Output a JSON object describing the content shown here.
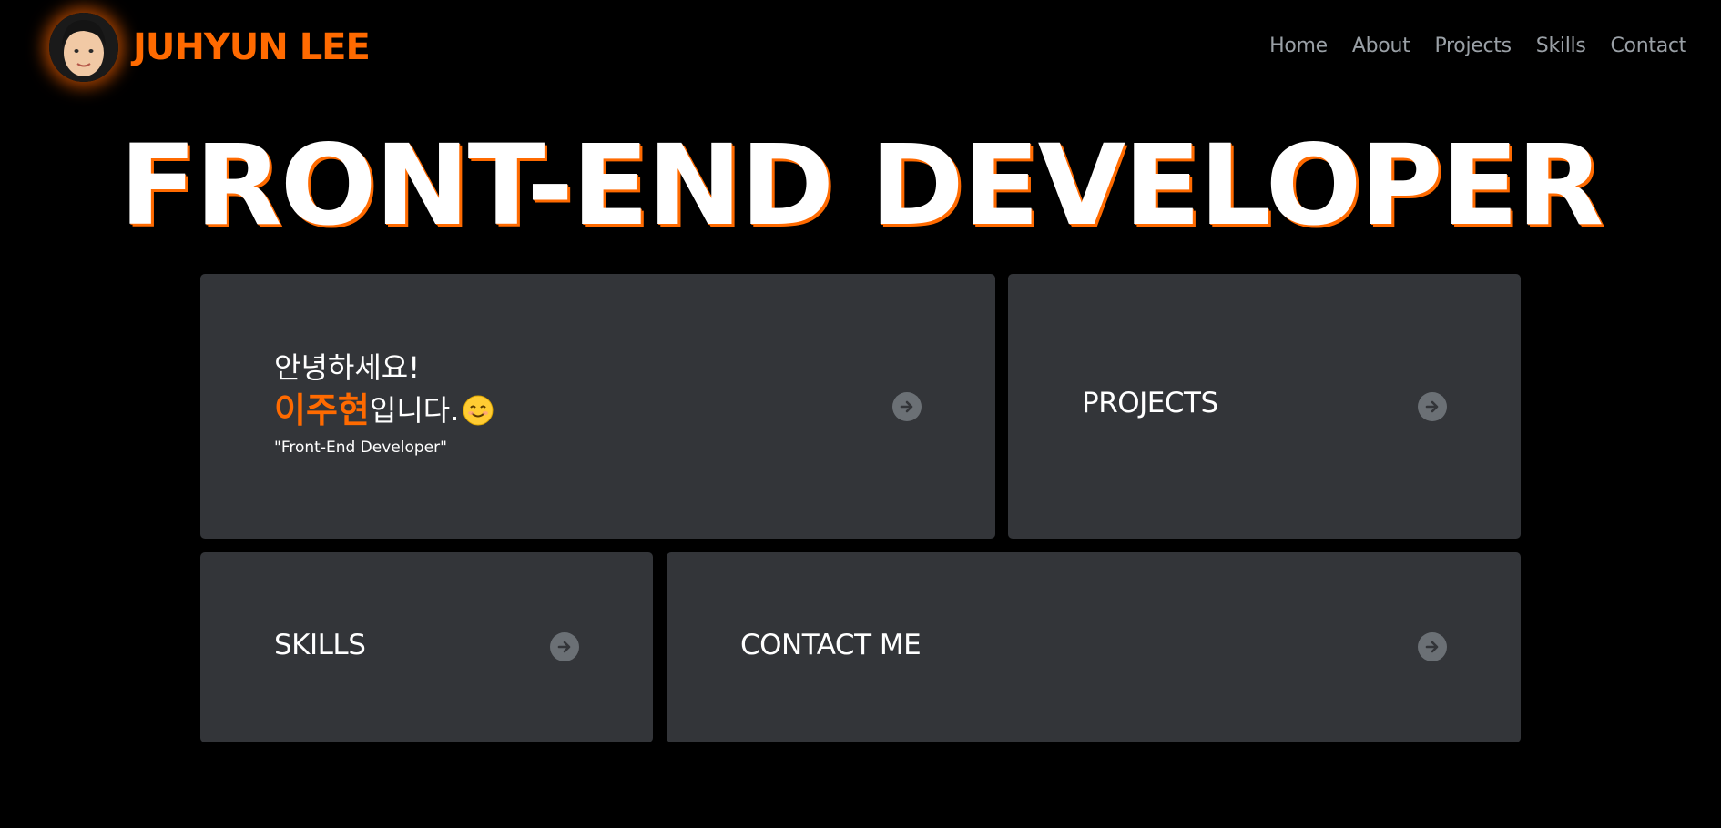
{
  "header": {
    "brand_name": "JUHYUN LEE",
    "nav": [
      {
        "label": "Home"
      },
      {
        "label": "About"
      },
      {
        "label": "Projects"
      },
      {
        "label": "Skills"
      },
      {
        "label": "Contact"
      }
    ]
  },
  "hero": {
    "title": "FRONT-END DEVELOPER"
  },
  "cards": {
    "intro": {
      "greeting": "안녕하세요!",
      "name": "이주현",
      "name_suffix": "입니다.",
      "tagline": "\"Front-End Developer\"",
      "arrow_icon": "arrow-right-icon"
    },
    "projects": {
      "label": "PROJECTS",
      "arrow_icon": "arrow-right-icon"
    },
    "skills": {
      "label": "SKILLS",
      "arrow_icon": "arrow-right-icon"
    },
    "contact": {
      "label": "CONTACT ME",
      "arrow_icon": "arrow-right-icon"
    }
  },
  "colors": {
    "background": "#000000",
    "accent": "#ff6a00",
    "card": "#333539",
    "nav_text": "#9aa0a6",
    "arrow_bg": "#6b7075"
  }
}
